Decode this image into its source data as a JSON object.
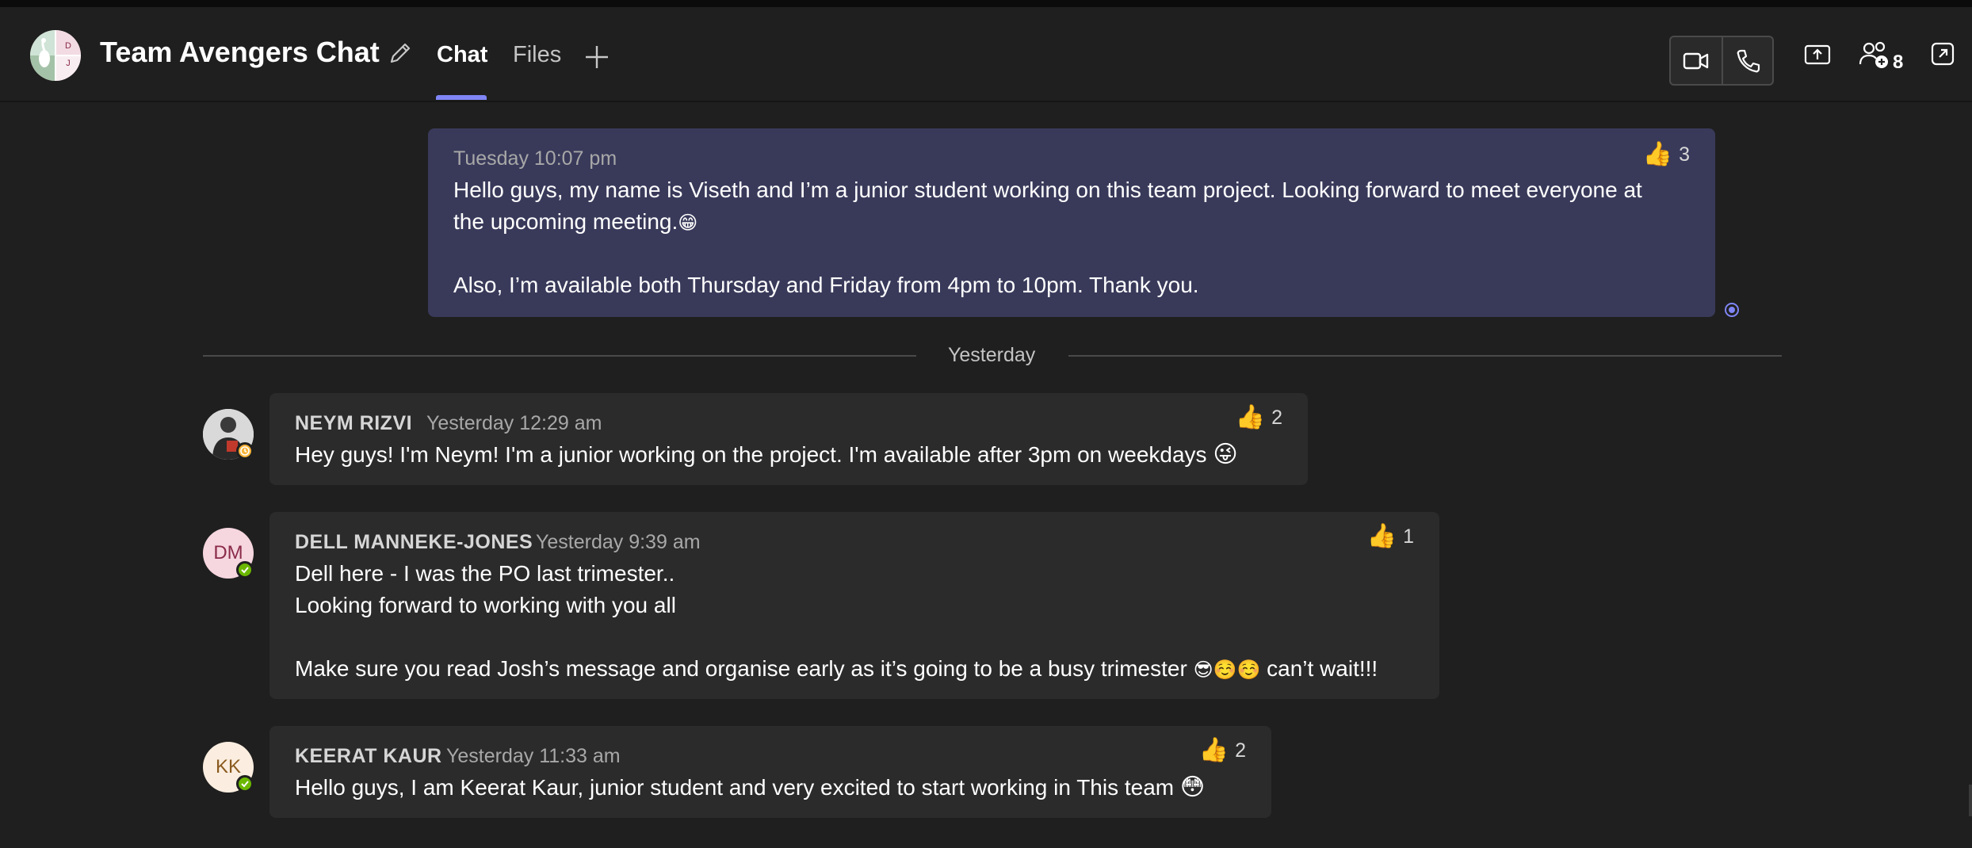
{
  "header": {
    "title": "Team Avengers Chat",
    "group_avatar_initials": {
      "top": "D",
      "bottom": "J"
    },
    "tabs": [
      {
        "label": "Chat",
        "active": true
      },
      {
        "label": "Files",
        "active": false
      }
    ],
    "participant_count": "8",
    "icons": {
      "edit": "pencil-icon",
      "add_tab": "plus-icon",
      "video_call": "video-camera-icon",
      "audio_call": "phone-icon",
      "share": "share-screen-icon",
      "participants": "people-add-icon",
      "pop_out": "pop-out-icon"
    },
    "accent_color": "#7f85f5"
  },
  "messages": [
    {
      "id": "self-1",
      "is_self": true,
      "timestamp": "Tuesday 10:07 pm",
      "lines": [
        "Hello guys, my name is Viseth and I’m a junior student working on this team project. Looking forward to meet everyone at",
        "the upcoming meeting.",
        "Also, I’m available both Thursday and Friday from 4pm to 10pm. Thank you."
      ],
      "emoji": "😁",
      "reaction": {
        "emoji": "👍",
        "count": "3"
      },
      "bubble_color": "#393a5a"
    },
    {
      "id": "neym",
      "sender": "NEYM RIZVI",
      "timestamp": "Yesterday 12:29 am",
      "lines": [
        "Hey guys! I'm Neym! I'm a junior working on the project. I'm available after 3pm on weekdays"
      ],
      "emoji": "😜",
      "reaction": {
        "emoji": "👍",
        "count": "2"
      },
      "status": "away"
    },
    {
      "id": "dell",
      "sender": "DELL MANNEKE-JONES",
      "initials": "DM",
      "timestamp": "Yesterday 9:39 am",
      "lines": [
        "Dell here - I was the PO last trimester..",
        "Looking forward to working with you all",
        "Make sure you read Josh’s message and organise early as it’s going to be a busy trimester",
        "can’t wait!!!"
      ],
      "emoji": "😎☺️☺️",
      "reaction": {
        "emoji": "👍",
        "count": "1"
      },
      "status": "available"
    },
    {
      "id": "keerat",
      "sender": "KEERAT KAUR",
      "initials": "KK",
      "timestamp": "Yesterday 11:33 am",
      "lines": [
        "Hello guys, I am Keerat Kaur, junior student and very excited to start working in This team"
      ],
      "emoji": "😳",
      "reaction": {
        "emoji": "👍",
        "count": "2"
      },
      "status": "available"
    }
  ],
  "date_divider": "Yesterday",
  "status_colors": {
    "away": "#f8b53a",
    "available": "#6bb700"
  }
}
